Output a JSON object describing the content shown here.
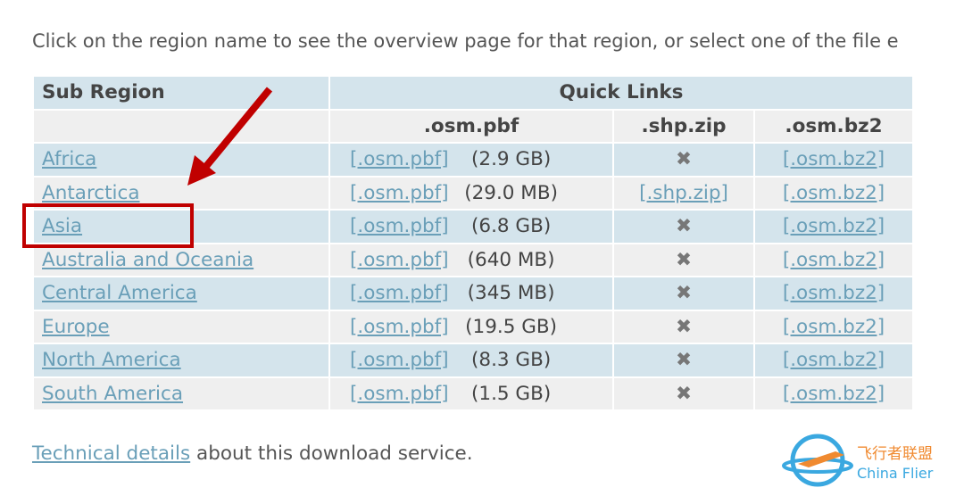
{
  "intro": "Click on the region name to see the overview page for that region, or select one of the file e",
  "headers": {
    "sub_region": "Sub Region",
    "quick_links": "Quick Links",
    "pbf": ".osm.pbf",
    "shp": ".shp.zip",
    "bz2": ".osm.bz2"
  },
  "rows": [
    {
      "name": "Africa",
      "pbf": "[.osm.pbf]",
      "size": "(2.9 GB)",
      "shp": "✖",
      "bz2": "[.osm.bz2]"
    },
    {
      "name": "Antarctica",
      "pbf": "[.osm.pbf]",
      "size": "(29.0 MB)",
      "shp": "[.shp.zip]",
      "bz2": "[.osm.bz2]"
    },
    {
      "name": "Asia",
      "pbf": "[.osm.pbf]",
      "size": "(6.8 GB)",
      "shp": "✖",
      "bz2": "[.osm.bz2]"
    },
    {
      "name": "Australia and Oceania",
      "pbf": "[.osm.pbf]",
      "size": "(640 MB)",
      "shp": "✖",
      "bz2": "[.osm.bz2]"
    },
    {
      "name": "Central America",
      "pbf": "[.osm.pbf]",
      "size": "(345 MB)",
      "shp": "✖",
      "bz2": "[.osm.bz2]"
    },
    {
      "name": "Europe",
      "pbf": "[.osm.pbf]",
      "size": "(19.5 GB)",
      "shp": "✖",
      "bz2": "[.osm.bz2]"
    },
    {
      "name": "North America",
      "pbf": "[.osm.pbf]",
      "size": "(8.3 GB)",
      "shp": "✖",
      "bz2": "[.osm.bz2]"
    },
    {
      "name": "South America",
      "pbf": "[.osm.pbf]",
      "size": "(1.5 GB)",
      "shp": "✖",
      "bz2": "[.osm.bz2]"
    }
  ],
  "footer": {
    "link": "Technical details",
    "text": " about this download service."
  },
  "logo": {
    "cn": "飞行者联盟",
    "en": "China Flier"
  },
  "colors": {
    "highlight": "#c00000",
    "link": "#6a9fb8",
    "row_blue": "#d4e4ec",
    "row_grey": "#efefef"
  }
}
